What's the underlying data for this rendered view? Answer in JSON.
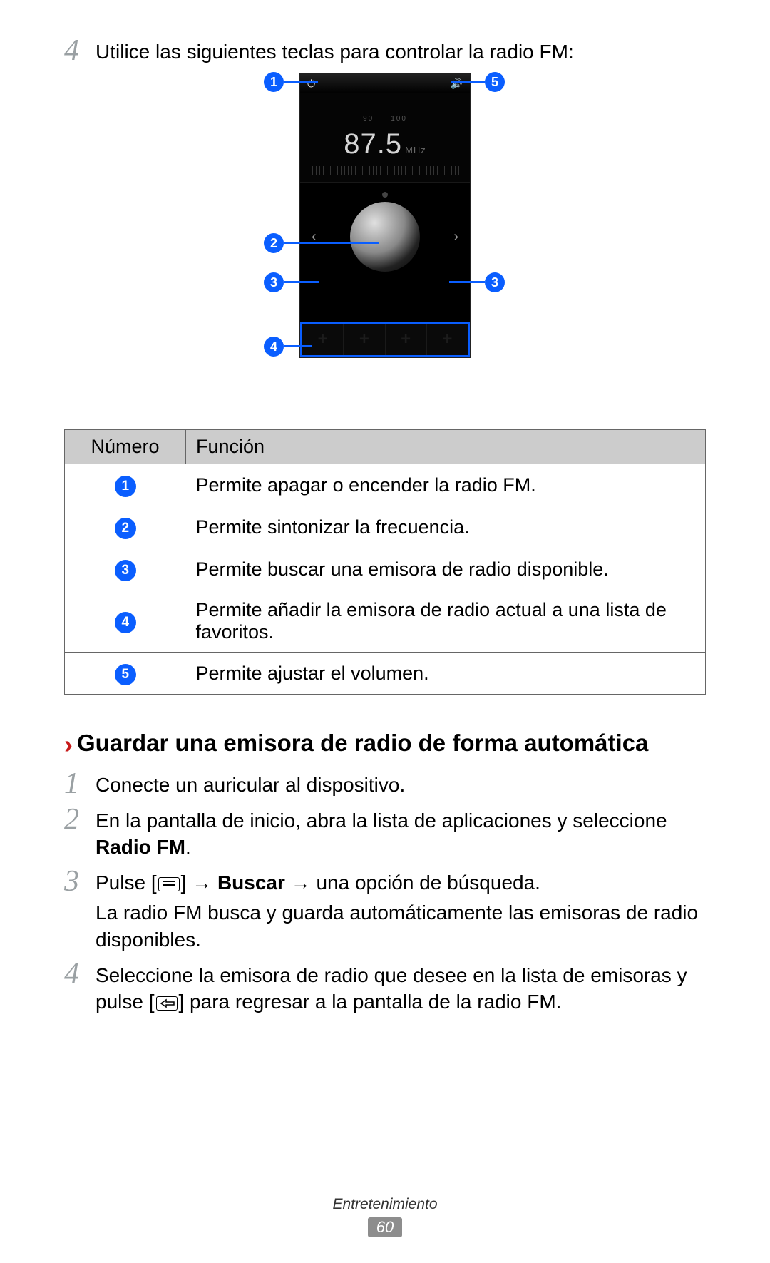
{
  "step4_intro": {
    "num": "4",
    "text": "Utilice las siguientes teclas para controlar la radio FM:"
  },
  "radio": {
    "freq_ticks": {
      "a": "90",
      "b": "100"
    },
    "frequency": "87.5",
    "unit": "MHz"
  },
  "callouts": {
    "c1": "1",
    "c2": "2",
    "c3": "3",
    "c4": "4",
    "c5": "5"
  },
  "table": {
    "header": {
      "num": "Número",
      "func": "Función"
    },
    "rows": [
      {
        "n": "1",
        "f": "Permite apagar o encender la radio FM."
      },
      {
        "n": "2",
        "f": "Permite sintonizar la frecuencia."
      },
      {
        "n": "3",
        "f": "Permite buscar una emisora de radio disponible."
      },
      {
        "n": "4",
        "f": "Permite añadir la emisora de radio actual a una lista de favoritos."
      },
      {
        "n": "5",
        "f": "Permite ajustar el volumen."
      }
    ]
  },
  "section": {
    "chevron": "›",
    "title": "Guardar una emisora de radio de forma automática"
  },
  "steps": {
    "s1": {
      "n": "1",
      "t": "Conecte un auricular al dispositivo."
    },
    "s2": {
      "n": "2",
      "t1": "En la pantalla de inicio, abra la lista de aplicaciones y seleccione ",
      "bold": "Radio FM",
      "t2": "."
    },
    "s3": {
      "n": "3",
      "pre": "Pulse [",
      "mid1": "] → ",
      "bold": "Buscar",
      "mid2": " → una opción de búsqueda.",
      "sub": "La radio FM busca y guarda automáticamente las emisoras de radio disponibles."
    },
    "s4": {
      "n": "4",
      "pre": "Seleccione la emisora de radio que desee en la lista de emisoras y pulse [",
      "post": "] para regresar a la pantalla de la radio FM."
    }
  },
  "footer": {
    "section": "Entretenimiento",
    "page": "60"
  }
}
